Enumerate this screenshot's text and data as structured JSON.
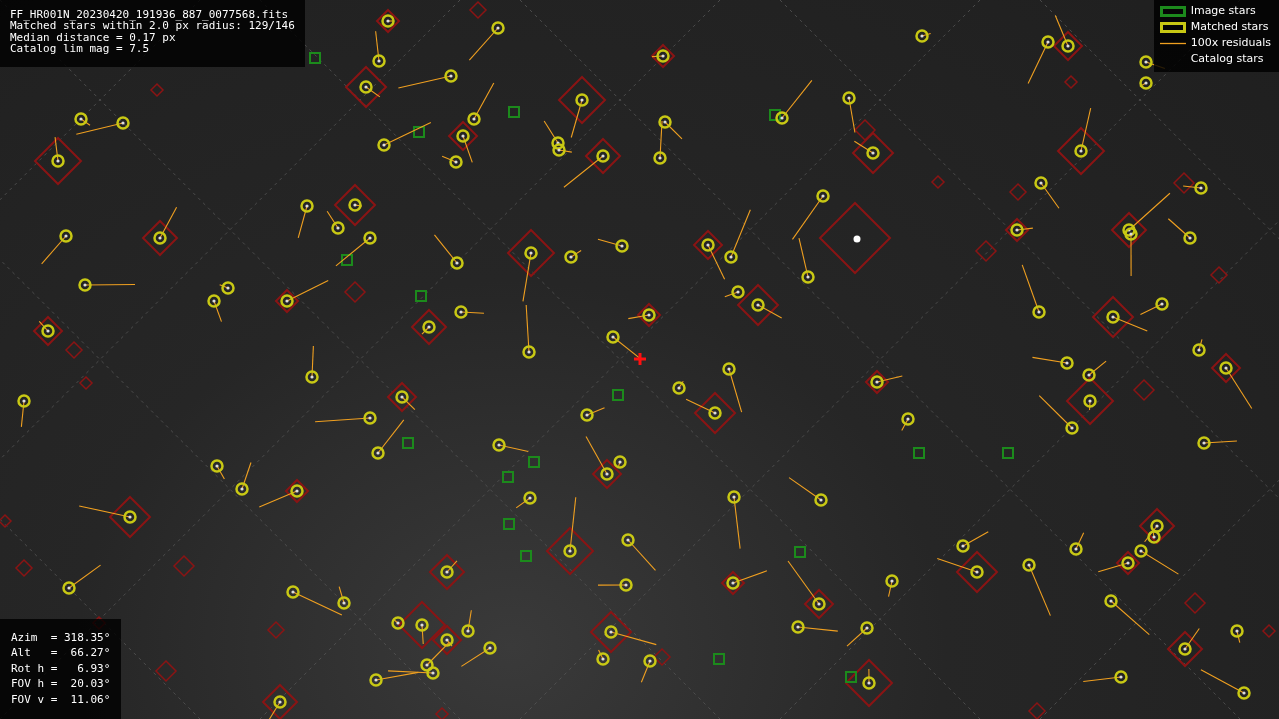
{
  "info_box": {
    "lines": [
      "FF_HR001N_20230420_191936_887_0077568.fits",
      "Matched stars within 2.0 px radius: 129/146",
      "Median distance = 0.17 px",
      "Catalog lim mag = 7.5"
    ]
  },
  "legend": {
    "items": [
      {
        "kind": "image",
        "label": "Image stars"
      },
      {
        "kind": "matched",
        "label": "Matched stars"
      },
      {
        "kind": "residual",
        "label": "100x residuals"
      },
      {
        "kind": "catalog",
        "label": "Catalog stars"
      }
    ]
  },
  "pointing_box": {
    "lines": [
      "Azim  = 318.35°",
      "Alt   =  66.27°",
      "Rot h =   6.93°",
      "FOV h =  20.03°",
      "FOV v =  11.06°"
    ]
  }
}
